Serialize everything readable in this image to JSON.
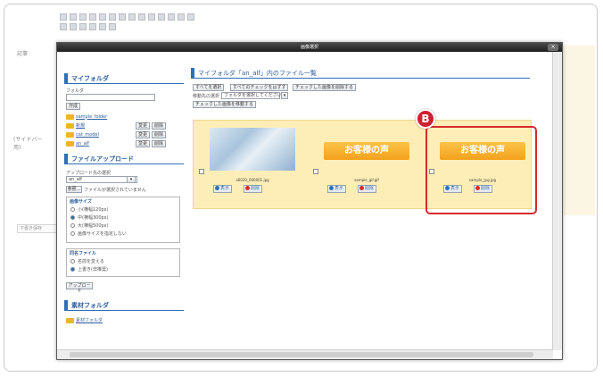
{
  "background": {
    "label_top": "記事",
    "label_mid": "(サイドバー用)",
    "strip_label": "下書き保存"
  },
  "modal": {
    "title": "画像選択",
    "close_label": "×"
  },
  "my_folder": {
    "heading": "マイフォルダ",
    "field_label": "フォルダ",
    "create_label": "作成",
    "folders": [
      {
        "name": "sample_folder",
        "actions": []
      },
      {
        "name": "新規",
        "actions": [
          "変更",
          "削除"
        ]
      },
      {
        "name": "cat_model",
        "actions": [
          "変更",
          "削除"
        ]
      },
      {
        "name": "an_alf",
        "actions": [
          "変更",
          "削除"
        ]
      }
    ]
  },
  "upload": {
    "heading": "ファイルアップロード",
    "dest_label": "アップロード先の選択",
    "dest_value": "an_alf",
    "browse_label": "参照...",
    "no_file_text": "ファイルが選択されていません",
    "size_box_title": "画像サイズ",
    "size_options": [
      "小(横幅120px)",
      "中(横幅300px)",
      "大(横幅500px)",
      "画像サイズを指定しない"
    ],
    "same_box_title": "同名ファイル",
    "same_options": [
      "名前を変える",
      "上書き(非推奨)"
    ],
    "upload_label": "アップロード"
  },
  "material": {
    "heading": "素材フォルダ",
    "folder_name": "素材フォルダ"
  },
  "main": {
    "heading": "マイフォルダ「an_alf」内のファイル一覧",
    "select_all_label": "すべてを選択",
    "deselect_all_label": "すべてのチェックをはずす",
    "delete_checked_label": "チェックした画像を削除する",
    "move_label": "移動先の選択",
    "move_select_value": "フォルダを選択してください",
    "move_checked_label": "チェックした画像を移動する",
    "files": [
      {
        "name": "a0020_000001.jpg",
        "kind": "photo",
        "thumb_text": ""
      },
      {
        "name": "sample_gif.gif",
        "kind": "text",
        "thumb_text": "お客様の声"
      },
      {
        "name": "sample_jpg.jpg",
        "kind": "text",
        "thumb_text": "お客様の声"
      }
    ],
    "display_label": "表示",
    "delete_label": "削除"
  },
  "callout": {
    "badge_label": "B",
    "color": "#d62b2b"
  },
  "colors": {
    "accent": "#2e6fb8",
    "file_area": "#fdeeb7",
    "thumb_orange": "#f3a21c"
  }
}
